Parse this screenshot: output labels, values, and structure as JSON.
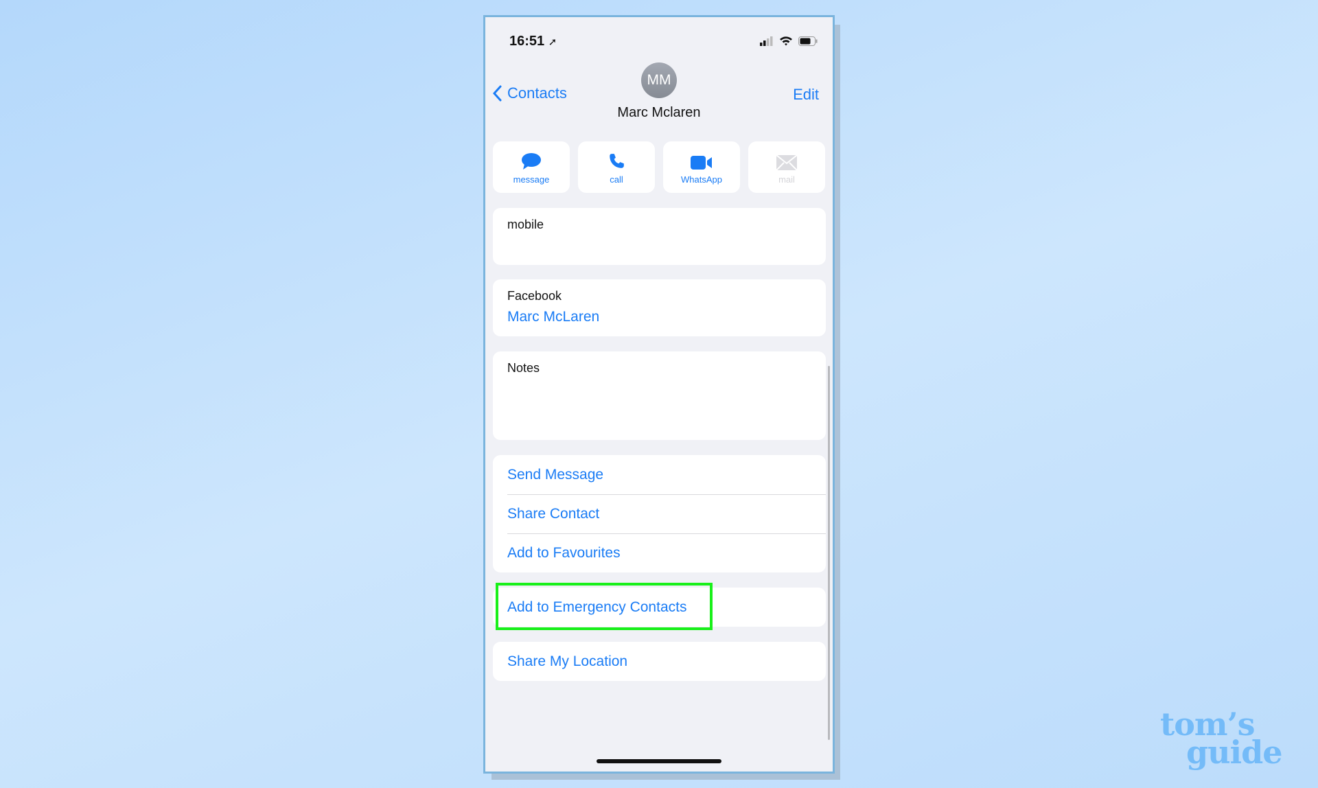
{
  "status": {
    "time": "16:51"
  },
  "nav": {
    "back_label": "Contacts",
    "edit_label": "Edit"
  },
  "contact": {
    "initials": "MM",
    "name": "Marc Mclaren"
  },
  "actions": [
    {
      "label": "message",
      "icon": "message-bubble-icon"
    },
    {
      "label": "call",
      "icon": "phone-icon"
    },
    {
      "label": "WhatsApp",
      "icon": "video-icon"
    },
    {
      "label": "mail",
      "icon": "mail-icon",
      "disabled": true
    }
  ],
  "fields": {
    "mobile_label": "mobile",
    "facebook_label": "Facebook",
    "facebook_value": "Marc McLaren",
    "notes_label": "Notes"
  },
  "menu": {
    "send_message": "Send Message",
    "share_contact": "Share Contact",
    "add_favourites": "Add to Favourites",
    "emergency": "Add to Emergency Contacts",
    "share_location": "Share My Location"
  },
  "colors": {
    "accent": "#1a7cf5",
    "highlight": "#19f01a"
  },
  "watermark": "tom's guide"
}
